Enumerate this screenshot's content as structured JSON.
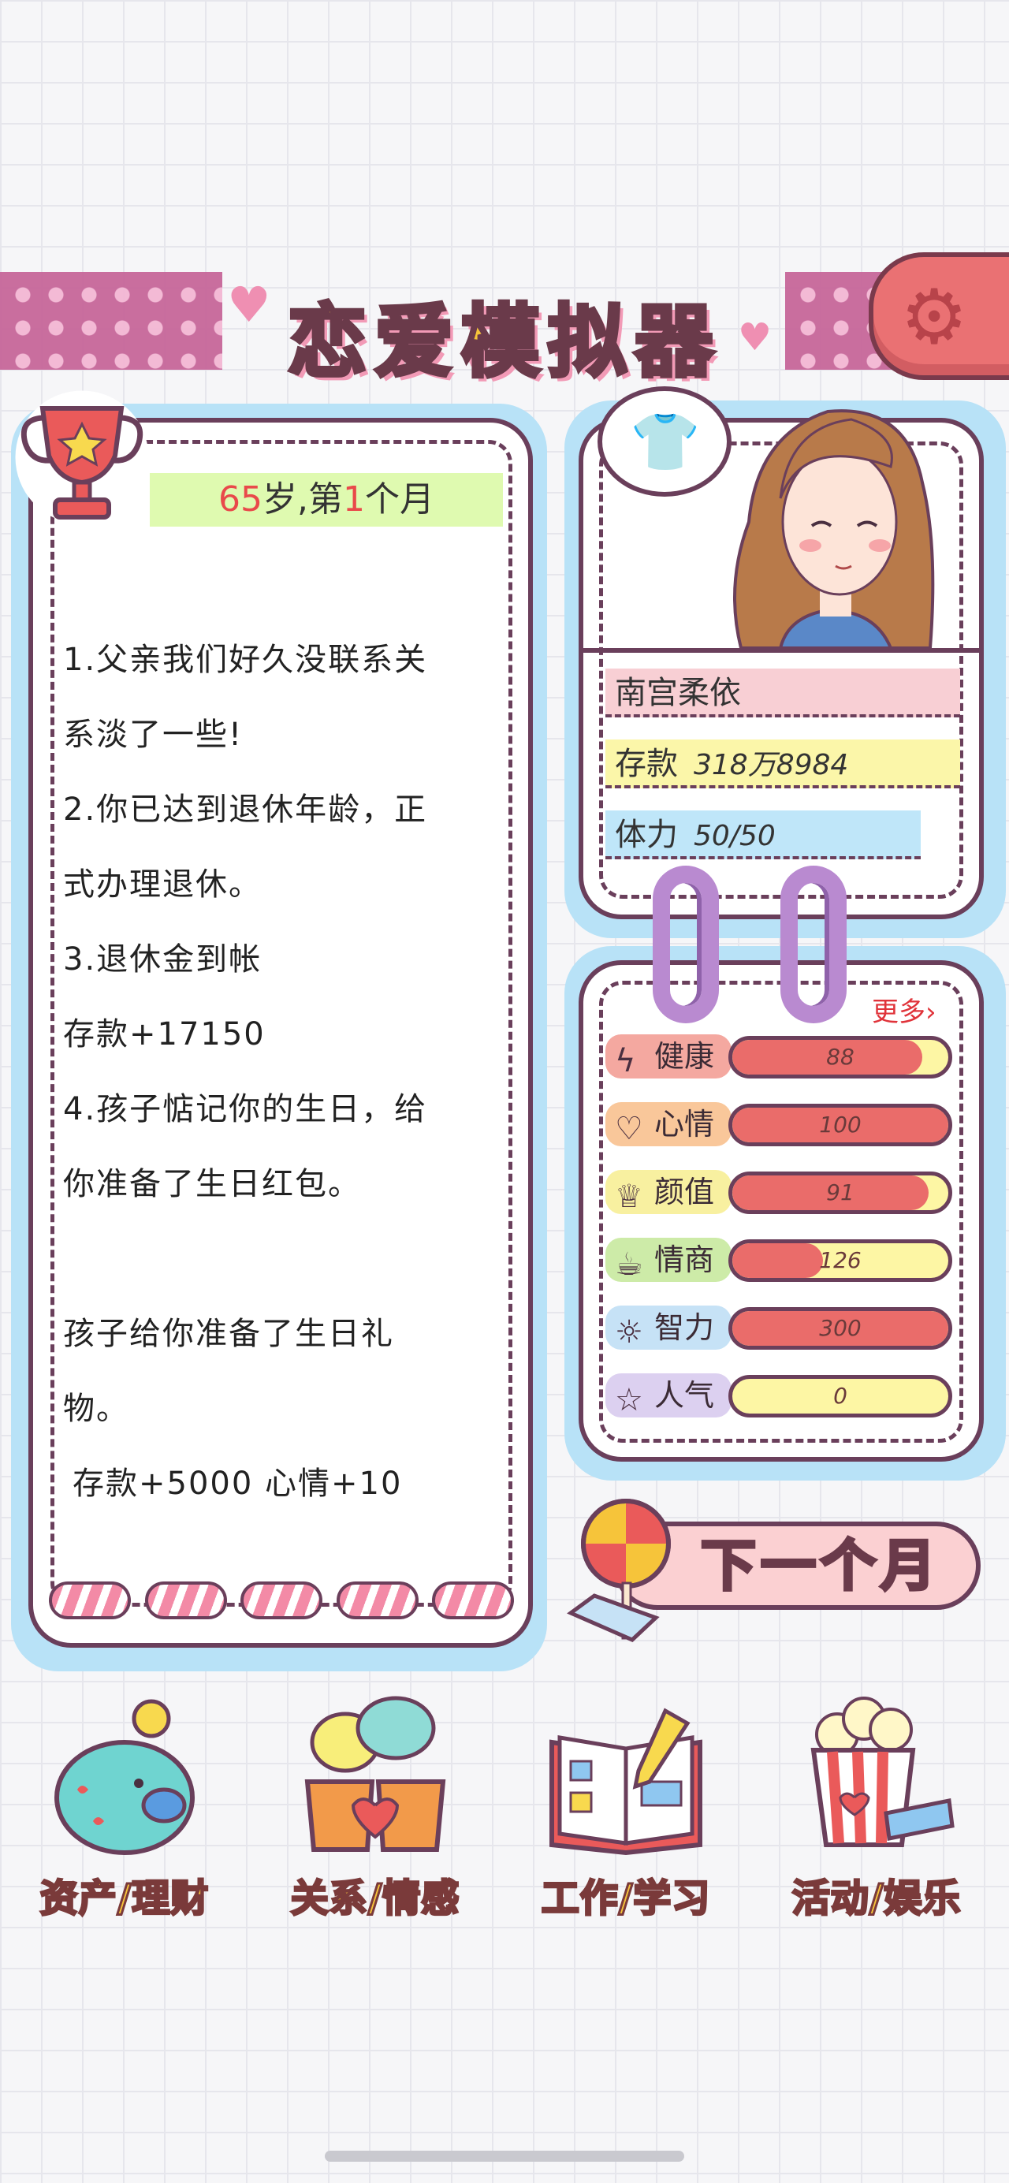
{
  "app": {
    "title": "恋爱模拟器"
  },
  "header": {
    "settings_icon": "gear-icon"
  },
  "log": {
    "age_num": "65",
    "age_suffix": "岁,第",
    "month_num": "1",
    "month_suffix": "个月",
    "entries": [
      {
        "line1": "1.父亲我们好久没联系关",
        "line2": "系淡了一些!"
      },
      {
        "line1": "2.你已达到退休年龄，正",
        "line2": "式办理退休。"
      },
      {
        "line1": "3.退休金到帐",
        "line2": "存款+17150"
      },
      {
        "line1": "4.孩子惦记你的生日，给",
        "line2": "你准备了生日红包。"
      }
    ],
    "gift_line1": "孩子给你准备了生日礼",
    "gift_line2": "物。",
    "gift_reward": "存款+5000 心情+10"
  },
  "profile": {
    "name": "南宫柔依",
    "money_label": "存款",
    "money_value": "318万8984",
    "stamina_label": "体力",
    "stamina_value": "50/50"
  },
  "stats": {
    "more_label": "更多›",
    "items": [
      {
        "label": "健康",
        "value": "88",
        "fill": 0.88,
        "icon": "lightning-icon",
        "color": "#f4a8a0"
      },
      {
        "label": "心情",
        "value": "100",
        "fill": 1.0,
        "icon": "heart-icon",
        "color": "#f9c79a"
      },
      {
        "label": "颜值",
        "value": "91",
        "fill": 0.91,
        "icon": "crown-icon",
        "color": "#f8f0a0"
      },
      {
        "label": "情商",
        "value": "126",
        "fill": 0.42,
        "icon": "cup-icon",
        "color": "#cdeba8"
      },
      {
        "label": "智力",
        "value": "300",
        "fill": 1.0,
        "icon": "bulb-icon",
        "color": "#c6e2f6"
      },
      {
        "label": "人气",
        "value": "0",
        "fill": 0.0,
        "icon": "star-icon",
        "color": "#dcd0f0"
      }
    ]
  },
  "actions": {
    "next_month": "下一个月"
  },
  "nav": [
    {
      "label": "资产/理财",
      "icon": "piggy-bank-icon"
    },
    {
      "label": "关系/情感",
      "icon": "coffee-cups-icon"
    },
    {
      "label": "工作/学习",
      "icon": "book-icon"
    },
    {
      "label": "活动/娱乐",
      "icon": "popcorn-icon"
    }
  ],
  "colors": {
    "accent": "#f6c43a",
    "outline": "#6a3f5b",
    "card_border": "#b8e2f7",
    "bar_fill": "#ea6c6a"
  }
}
